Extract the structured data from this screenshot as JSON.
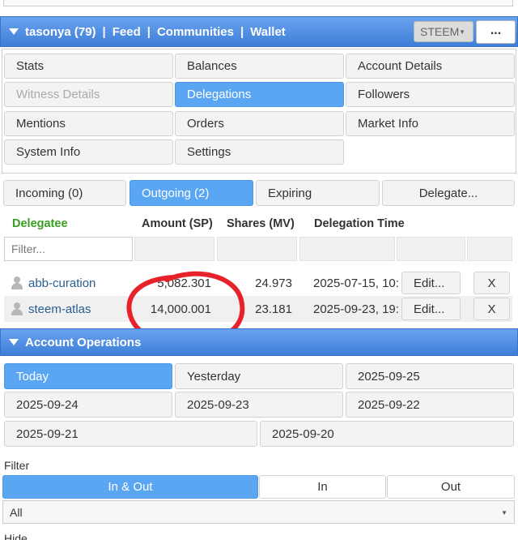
{
  "header": {
    "user": "tasonya (79)",
    "sep": "|",
    "nav": [
      "Feed",
      "Communities",
      "Wallet"
    ],
    "currency": "STEEM",
    "more": "..."
  },
  "menu": {
    "items": [
      "Stats",
      "Balances",
      "Account Details",
      "Witness Details",
      "Delegations",
      "Followers",
      "Mentions",
      "Orders",
      "Market Info",
      "System Info",
      "Settings"
    ],
    "active": "Delegations",
    "disabled": "Witness Details"
  },
  "delegation_tabs": {
    "incoming": "Incoming (0)",
    "outgoing": "Outgoing (2)",
    "expiring": "Expiring",
    "delegate": "Delegate..."
  },
  "table": {
    "headers": [
      "Delegatee",
      "Amount (SP)",
      "Shares (MV)",
      "Delegation Time"
    ],
    "filter_placeholder": "Filter...",
    "rows": [
      {
        "delegatee": "abb-curation",
        "amount": "5,082.301",
        "shares": "24.973",
        "time": "2025-07-15, 10:",
        "edit": "Edit...",
        "remove": "X"
      },
      {
        "delegatee": "steem-atlas",
        "amount": "14,000.001",
        "shares": "23.181",
        "time": "2025-09-23, 19:",
        "edit": "Edit...",
        "remove": "X"
      }
    ]
  },
  "operations": {
    "title": "Account Operations",
    "dates": [
      "Today",
      "Yesterday",
      "2025-09-25",
      "2025-09-24",
      "2025-09-23",
      "2025-09-22",
      "2025-09-21",
      "2025-09-20"
    ],
    "filter_label": "Filter",
    "direction_tabs": [
      "In & Out",
      "In",
      "Out"
    ],
    "filter_select": "All",
    "hide_label": "Hide"
  },
  "colors": {
    "header_blue": "#4a8ae0",
    "active_blue": "#5aa6f3",
    "delegatee_green": "#3a9e22",
    "annotation_red": "#e8222b"
  }
}
